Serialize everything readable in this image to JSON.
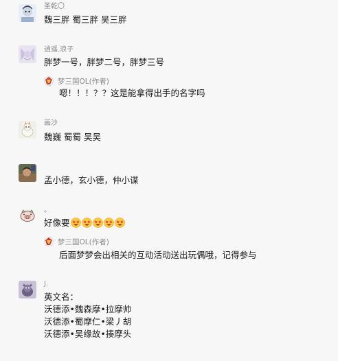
{
  "comments": [
    {
      "user": "圣乾〇",
      "text": "魏三胖 蜀三胖 吴三胖"
    },
    {
      "user": "逍遥.浪子",
      "text": "胖梦一号，胖梦二号，胖梦三号",
      "reply": {
        "author": "梦三国OL(作者)",
        "text": "嗯！！！？？这是能拿得出手的名字吗"
      }
    },
    {
      "user": "画沙",
      "text": "魏巍 蜀蜀 吴吴"
    },
    {
      "user": "",
      "text": "孟小德，玄小德，仲小谋"
    },
    {
      "user": "。",
      "text": "好像要",
      "emoji": [
        "star-struck-emoji",
        "star-struck-emoji",
        "star-struck-emoji",
        "star-struck-emoji",
        "star-struck-emoji"
      ],
      "reply": {
        "author": "梦三国OL(作者)",
        "text": "后面梦梦会出相关的互动活动送出玩偶哦，记得参与"
      }
    },
    {
      "user": "J.",
      "lines": [
        "英文名：",
        "沃德添•魏森摩•拉摩帅",
        "沃德添•蜀摩仁•梁丿胡",
        "沃德添•吴缘故•揍摩头"
      ]
    }
  ],
  "colors": {
    "background": "#f7f7f7",
    "username": "#8a8a8a",
    "text": "#1b1b1b"
  }
}
